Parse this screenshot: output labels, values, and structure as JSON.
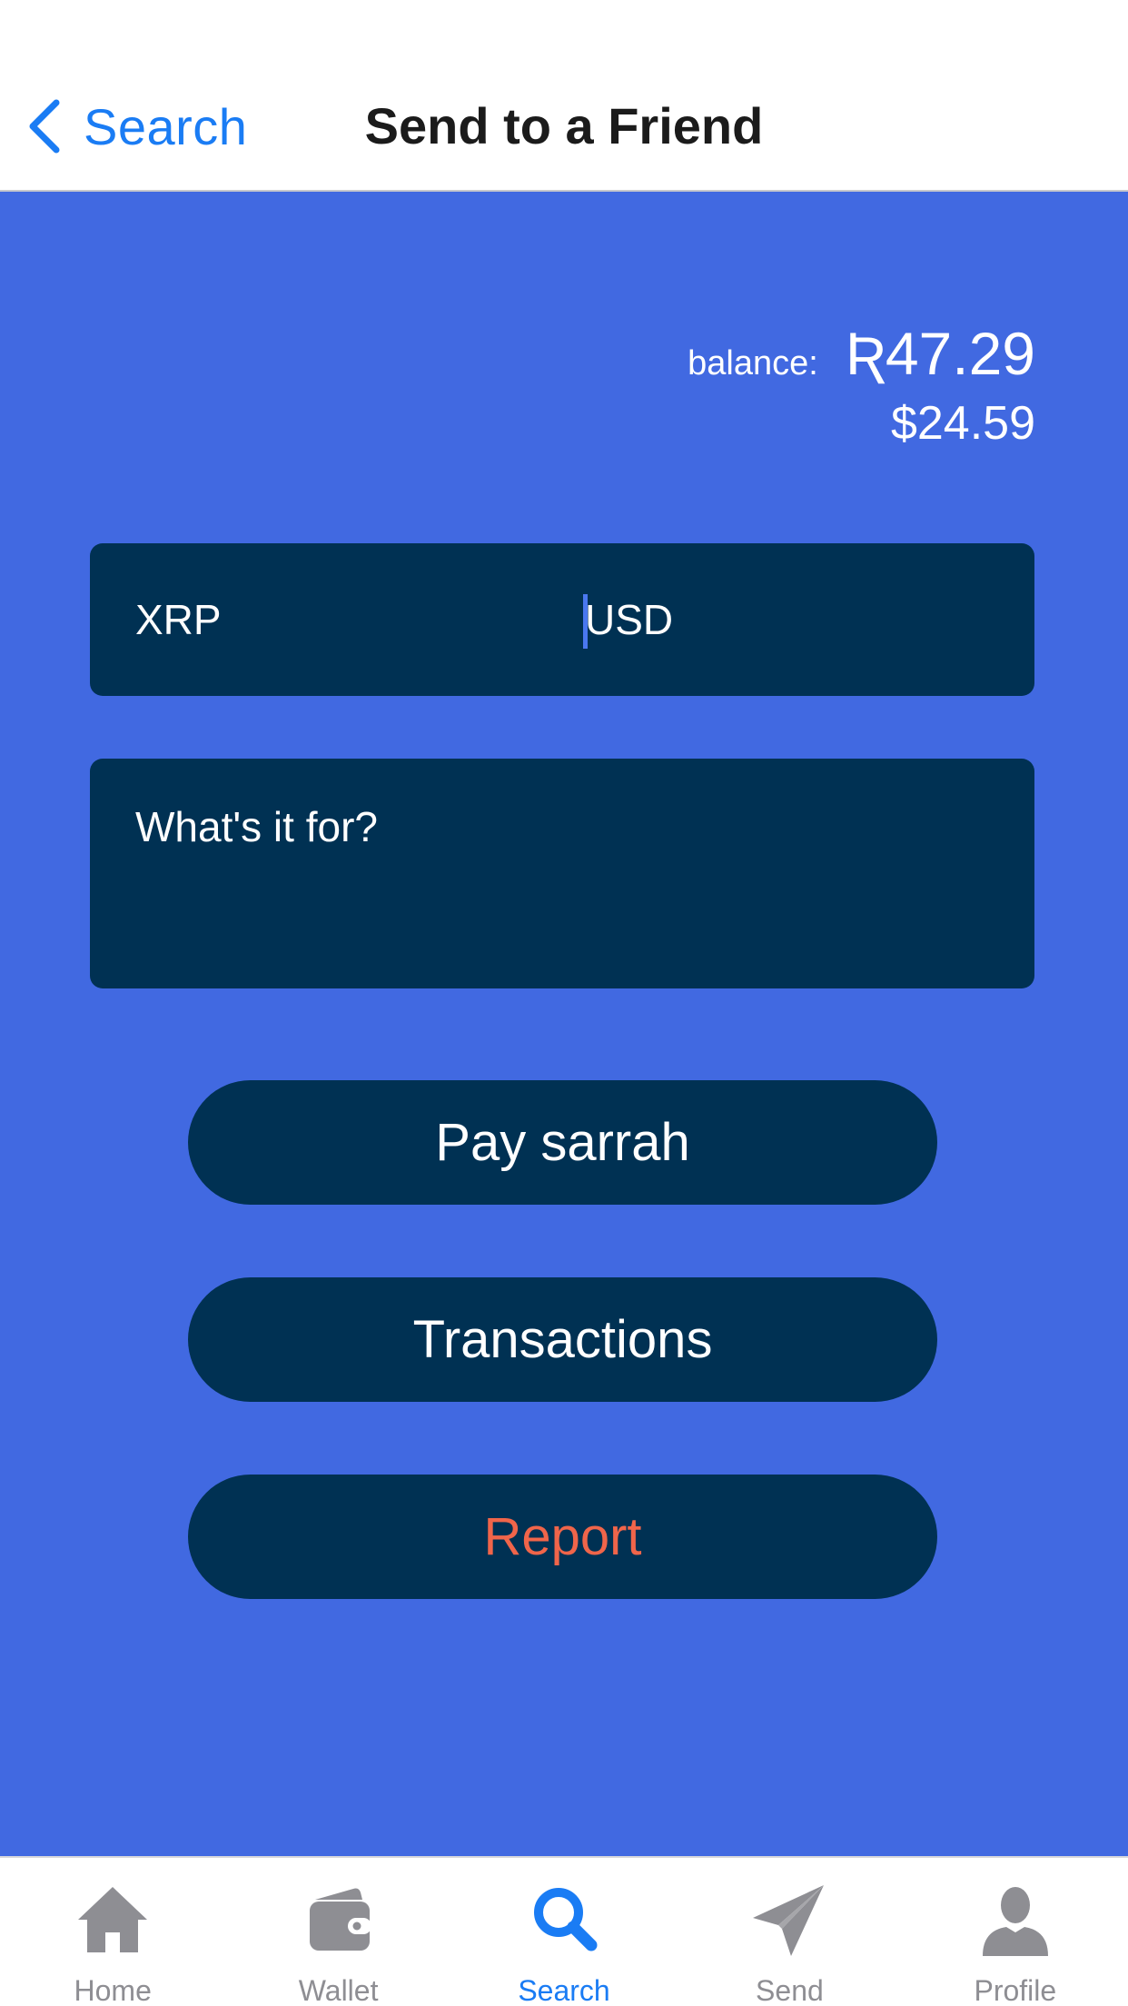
{
  "nav": {
    "back_label": "Search",
    "title": "Send to a Friend"
  },
  "balance": {
    "label": "balance:",
    "xrp": "Ʀ47.29",
    "usd": "$24.59"
  },
  "amount": {
    "xrp_placeholder": "XRP",
    "usd_placeholder": "USD"
  },
  "memo": {
    "placeholder": "What's it for?"
  },
  "buttons": {
    "pay": "Pay sarrah",
    "transactions": "Transactions",
    "report": "Report"
  },
  "tabs": [
    {
      "label": "Home",
      "icon": "home-icon",
      "active": false
    },
    {
      "label": "Wallet",
      "icon": "wallet-icon",
      "active": false
    },
    {
      "label": "Search",
      "icon": "search-icon",
      "active": true
    },
    {
      "label": "Send",
      "icon": "send-icon",
      "active": false
    },
    {
      "label": "Profile",
      "icon": "profile-icon",
      "active": false
    }
  ],
  "colors": {
    "accent": "#1a7cf4",
    "background": "#4169e1",
    "field": "#003153",
    "report_text": "#f0654a",
    "tab_inactive": "#8e8e93"
  }
}
